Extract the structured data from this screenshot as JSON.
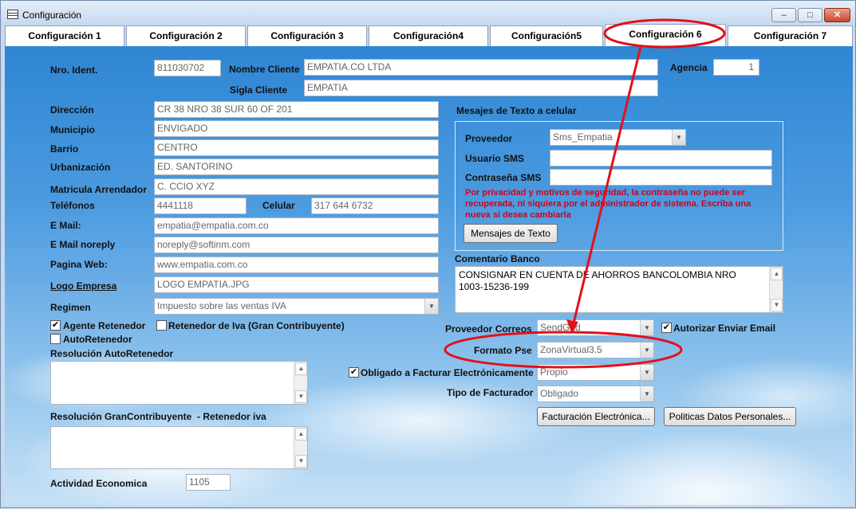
{
  "window": {
    "title": "Configuración",
    "min": "–",
    "max": "□",
    "close": "✕"
  },
  "tabs": [
    "Configuración 1",
    "Configuración 2",
    "Configuración 3",
    "Configuración4",
    "Configuración5",
    "Configuración 6",
    "Configuración 7"
  ],
  "active_tab": "Configuración 6",
  "form": {
    "nro_ident": {
      "label": "Nro. Ident.",
      "value": "811030702"
    },
    "nombre_cliente": {
      "label": "Nombre Cliente",
      "value": "EMPATIA.CO LTDA"
    },
    "agencia": {
      "label": "Agencia",
      "value": "1"
    },
    "sigla_cliente": {
      "label": "Sigla Cliente",
      "value": "EMPATIA"
    },
    "direccion": {
      "label": "Dirección",
      "value": "CR 38 NRO 38 SUR 60 OF 201"
    },
    "municipio": {
      "label": "Municipio",
      "value": "ENVIGADO"
    },
    "barrio": {
      "label": "Barrio",
      "value": "CENTRO"
    },
    "urbanizacion": {
      "label": "Urbanización",
      "value": "ED. SANTORINO"
    },
    "matricula": {
      "label": "Matricula Arrendador",
      "value": "C. CCIO XYZ"
    },
    "telefonos": {
      "label": "Teléfonos",
      "value": "4441118"
    },
    "celular": {
      "label": "Celular",
      "value": "317 644 6732"
    },
    "email": {
      "label": "E Mail:",
      "value": "empatia@empatia.com.co"
    },
    "email_noreply": {
      "label": "E Mail noreply",
      "value": "noreply@softinm.com"
    },
    "pagina_web": {
      "label": "Pagina Web:",
      "value": "www.empatia.com.co"
    },
    "logo_empresa": {
      "label": "Logo Empresa",
      "value": "LOGO EMPATIA.JPG"
    },
    "regimen": {
      "label": "Regimen",
      "value": "Impuesto sobre las ventas IVA"
    },
    "agente_retenedor": {
      "label": "Agente Retenedor",
      "checked": true
    },
    "retenedor_iva": {
      "label": "Retenedor de Iva (Gran Contribuyente)",
      "checked": false
    },
    "autoretenedor": {
      "label": "AutoRetenedor",
      "checked": false
    },
    "resolucion_auto": {
      "label": "Resolución AutoRetenedor",
      "value": ""
    },
    "resolucion_gran": {
      "label": "Resolución GranContribuyente  - Retenedor iva",
      "value": ""
    },
    "actividad": {
      "label": "Actividad Economica",
      "value": "1105"
    }
  },
  "sms": {
    "title": "Mesajes de Texto a celular",
    "proveedor": {
      "label": "Proveedor",
      "value": "Sms_Empatia"
    },
    "usuario": {
      "label": "Usuario SMS",
      "value": ""
    },
    "contrasena": {
      "label": "Contraseña SMS",
      "value": ""
    },
    "warning": "Por privacidad y motivos de seguridad, la contraseña no puede ser recuperada, ni siquiera por el administrador de sistema. Escriba una nueva si desea cambiarla",
    "button": "Mensajes de Texto"
  },
  "comentario": {
    "label": "Comentario Banco",
    "value": "CONSIGNAR EN CUENTA DE AHORROS BANCOLOMBIA NRO 1003-15236-199"
  },
  "right": {
    "proveedor_correos": {
      "label": "Proveedor Correos",
      "value": "SendGrid"
    },
    "autorizar_email": {
      "label": "Autorizar Enviar Email",
      "checked": true
    },
    "formato_pse": {
      "label": "Formato Pse",
      "value": "ZonaVirtual3.5"
    },
    "obligado": {
      "label": "Obligado a Facturar Electrónicamente",
      "checked": true,
      "value": "Propio"
    },
    "tipo_facturador": {
      "label": "Tipo de Facturador",
      "value": "Obligado"
    },
    "btn_facturacion": "Facturación Electrónica...",
    "btn_politicas": "Politicas Datos Personales..."
  },
  "annotation_color": "#e3101a"
}
